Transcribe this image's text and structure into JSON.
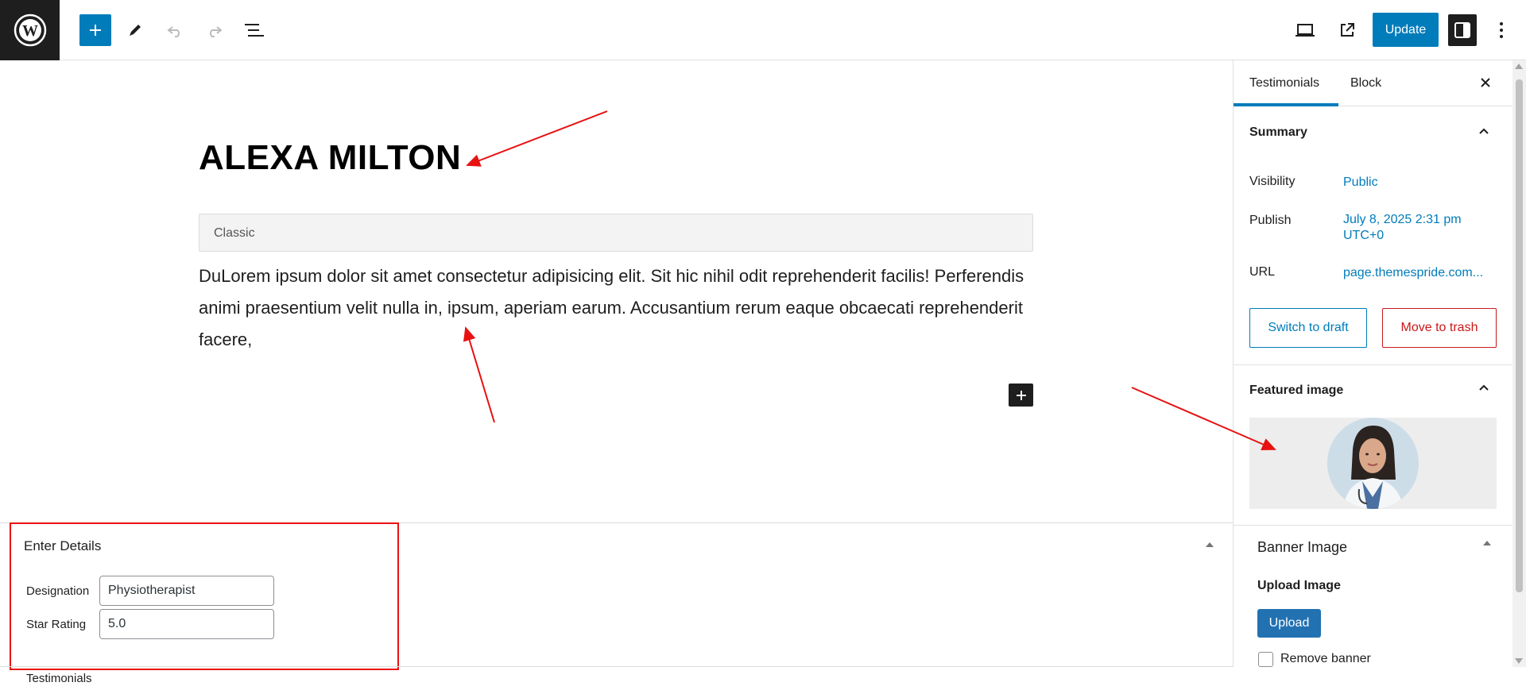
{
  "toolbar": {
    "logo_icon": "wordpress-logo-icon",
    "add_block_icon": "plus-icon",
    "tools_icon": "pencil-icon",
    "undo_icon": "undo-icon",
    "redo_icon": "redo-icon",
    "list_view_icon": "list-view-icon",
    "preview_icon": "laptop-icon",
    "view_post_icon": "external-link-icon",
    "update_label": "Update",
    "settings_icon": "sidebar-toggle-icon",
    "options_icon": "more-vertical-icon",
    "accent_color": "#007cba"
  },
  "editor": {
    "title": "ALEXA MILTON",
    "classic_label": "Classic",
    "body_text": "DuLorem ipsum dolor sit amet consectetur adipisicing elit. Sit hic nihil odit reprehenderit facilis! Perferendis animi praesentium velit nulla in, ipsum, aperiam earum. Accusantium rerum eaque obcaecati reprehenderit facere,",
    "add_block_icon": "plus-icon"
  },
  "metabox": {
    "title": "Enter Details",
    "designation_label": "Designation",
    "designation_value": "Physiotherapist",
    "rating_label": "Star Rating",
    "rating_value": "5.0",
    "highlight_color": "#e81111"
  },
  "breadcrumb": "Testimonials",
  "sidebar": {
    "tabs": [
      "Testimonials",
      "Block"
    ],
    "active_tab": "Testimonials",
    "summary": {
      "title": "Summary",
      "visibility_label": "Visibility",
      "visibility_value": "Public",
      "publish_label": "Publish",
      "publish_value_line1": "July 8, 2025 2:31 pm",
      "publish_value_line2": "UTC+0",
      "url_label": "URL",
      "url_value": "page.themespride.com...",
      "switch_draft_label": "Switch to draft",
      "trash_label": "Move to trash"
    },
    "featured_image": {
      "title": "Featured image",
      "image_description": "portrait of woman doctor"
    },
    "banner": {
      "title": "Banner Image",
      "upload_label": "Upload Image",
      "upload_button": "Upload",
      "remove_label": "Remove banner"
    }
  }
}
